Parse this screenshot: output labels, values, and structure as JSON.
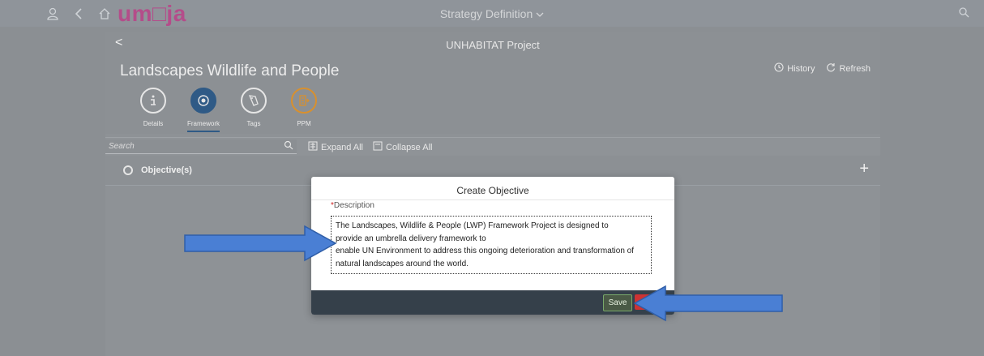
{
  "shell": {
    "logo_main": "um",
    "logo_box": "□",
    "logo_tail": "ja",
    "app_title": "Strategy Definition",
    "icons": [
      "person-icon",
      "back-icon",
      "home-icon",
      "search-icon"
    ]
  },
  "header": {
    "project_name": "UNHABITAT Project",
    "back_label": "<",
    "title": "Landscapes Wildlife and People",
    "history_label": "History",
    "refresh_label": "Refresh"
  },
  "tabs": [
    {
      "label": "Details",
      "icon": "info-icon"
    },
    {
      "label": "Framework",
      "icon": "target-icon",
      "active": true
    },
    {
      "label": "Tags",
      "icon": "tag-icon"
    },
    {
      "label": "PPM",
      "icon": "ppm-icon"
    }
  ],
  "toolbar": {
    "search_placeholder": "Search",
    "expand_all_label": "Expand All",
    "collapse_all_label": "Collapse All"
  },
  "tree": {
    "objectives_label": "Objective(s)",
    "add_label": "+"
  },
  "dialog": {
    "title": "Create Objective",
    "required_mark": "*",
    "description_label": "Description",
    "description_lines": [
      "The Landscapes, Wildlife & People (LWP) Framework Project is designed to",
      "provide an umbrella delivery framework to",
      "enable UN Environment to address this ongoing deterioration and transformation of",
      "natural landscapes around the world."
    ],
    "save_label": "Save"
  },
  "colors": {
    "logo": "#b44d8a",
    "active_tab": "#2f5a86",
    "ppm": "#d8902e",
    "arrow": "#4a7fd4",
    "footer": "#35404a"
  }
}
